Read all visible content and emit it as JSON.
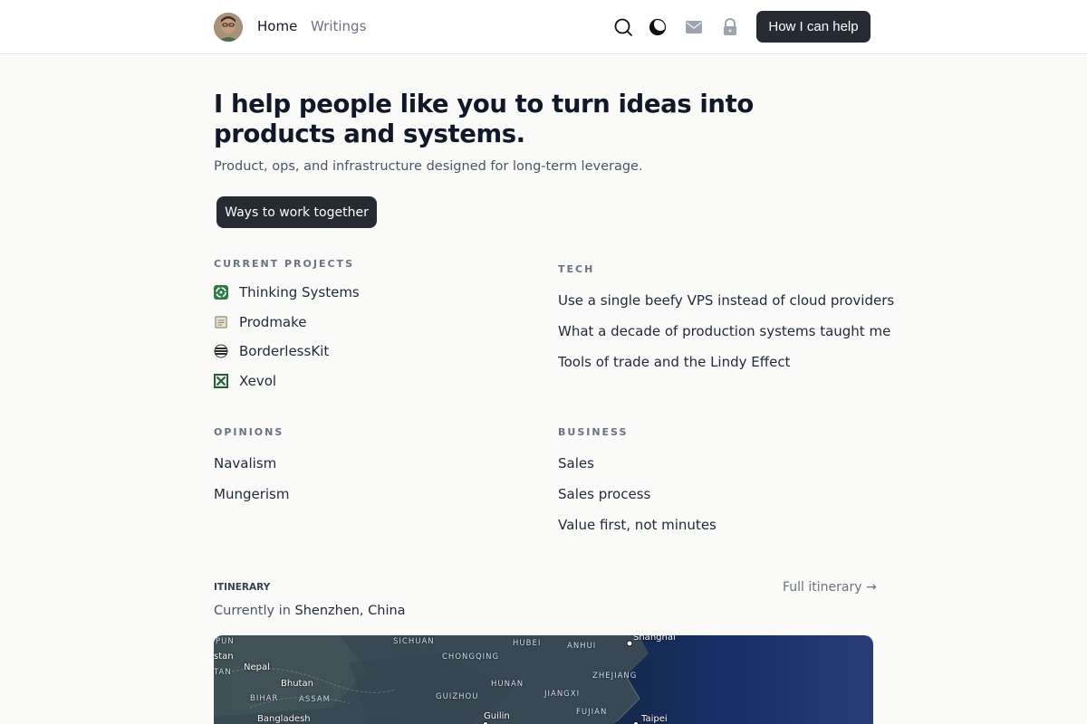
{
  "nav": {
    "home": "Home",
    "writings": "Writings",
    "help_button": "How I can help",
    "icons": [
      "search-icon",
      "moon-icon",
      "mail-icon",
      "lock-icon"
    ]
  },
  "hero": {
    "title": "I help people like you to turn ideas into products and systems.",
    "subtitle": "Product, ops, and infrastructure designed for long-term leverage.",
    "cta": "Ways to work together"
  },
  "current_projects": {
    "heading": "CURRENT PROJECTS",
    "items": [
      {
        "label": "Thinking Systems",
        "icon": "recycle-icon"
      },
      {
        "label": "Prodmake",
        "icon": "notebook-icon"
      },
      {
        "label": "BorderlessKit",
        "icon": "globe-stripes-icon"
      },
      {
        "label": "Xevol",
        "icon": "x-box-icon"
      }
    ]
  },
  "tech": {
    "heading": "TECH",
    "items": [
      "Use a single beefy VPS instead of cloud providers",
      "What a decade of production systems taught me",
      "Tools of trade and the Lindy Effect"
    ]
  },
  "opinions": {
    "heading": "OPINIONS",
    "items": [
      "Navalism",
      "Mungerism"
    ]
  },
  "business": {
    "heading": "BUSINESS",
    "items": [
      "Sales",
      "Sales process",
      "Value first, not minutes"
    ]
  },
  "itinerary": {
    "heading": "ITINERARY",
    "full_link": "Full itinerary →",
    "current_prefix": "Currently in",
    "current_location": "Shenzhen, China",
    "map_labels": [
      "SICHUAN",
      "HUBEI",
      "ANHUI",
      "CHONGQING",
      "ZHEJIANG",
      "HUNAN",
      "JIANGXI",
      "GUIZHOU",
      "FUJIAN",
      "BIHAR",
      "ASSAM",
      "stan",
      "TAN"
    ],
    "map_cities": [
      "Shanghai",
      "Nepal",
      "Bhutan",
      "Guilin",
      "Taipei",
      "Bangladesh",
      "PUN"
    ]
  },
  "colors": {
    "button_bg": "#252a33",
    "page_bg": "#fafaf9",
    "heading_text": "#111827",
    "muted_text": "#6b7280"
  }
}
